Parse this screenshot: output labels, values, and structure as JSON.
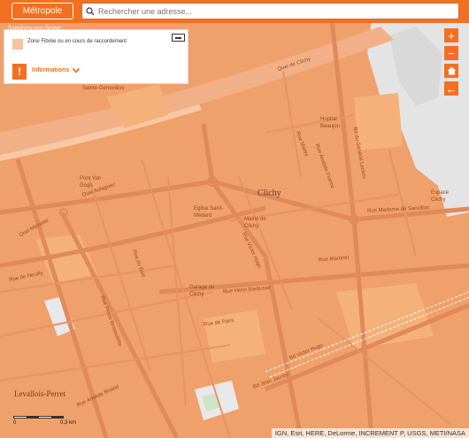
{
  "header": {
    "metropole_label": "Métropole",
    "search_placeholder": "Rechercher une adresse..."
  },
  "legend": {
    "zone_label": "Zone Fibrée ou en cours de raccordement",
    "info_label": "Informations",
    "swatch_color": "#f6c2a0"
  },
  "controls": {
    "zoom_in": "+",
    "zoom_out": "−",
    "back": "←"
  },
  "scale": {
    "zero": "0",
    "distance": "0,3 km"
  },
  "attribution": "IGN, Esri, HERE, DeLorme, INCREMENT P, USGS, METI/NASA",
  "map_labels": {
    "clichy": "Clichy",
    "levallois": "Levallois-Perret",
    "asnieres": "Asnières-sur-Seine",
    "hopital": "Hopital Beaujon",
    "eglise": "Eglise Saint-Médard",
    "mairie": "Mairie de Clichy",
    "garage": "Garage de Clichy",
    "pont": "Pont Van Gogh",
    "sainte_genevieve": "Sainte-Geneviève",
    "espace": "Espace Clichy",
    "quai_clichy": "Quai de Clichy",
    "quai_michelet": "Quai Michelet",
    "quai_aulagnier": "Quai Aulagnier",
    "rue_martre": "Rue Martre",
    "rue_mme_sanzillon": "Rue Madame de Sanzillon",
    "bd_general_leclerc": "Bd du Général Leclerc",
    "rue_anatole_france": "Rue Anatole France",
    "rue_victor_hugo": "Rue Victor Hugo",
    "bd_victor_hugo": "Bd Victor Hugo",
    "rue_henri_barbusse": "Rue Henri Barbusse",
    "rue_du_bois": "Rue du Bois",
    "rue_de_paris": "Rue de Paris",
    "rue_pierre_brossolette": "Rue Pierre Brossolette",
    "rue_de_neuilly": "Rue de Neuilly",
    "rue_ariste_briand": "Rue Aristide Briand",
    "bd_jean_jaures": "Bd Jean Jaurès",
    "rue_martinet": "Rue Martinet"
  },
  "colors": {
    "brand": "#f37021",
    "fiber_zone": "#f0a06a",
    "fiber_zone_light": "#f6c2a0",
    "river": "#f2b088",
    "road": "#e0895a",
    "unfibered": "#e4e4e4"
  }
}
